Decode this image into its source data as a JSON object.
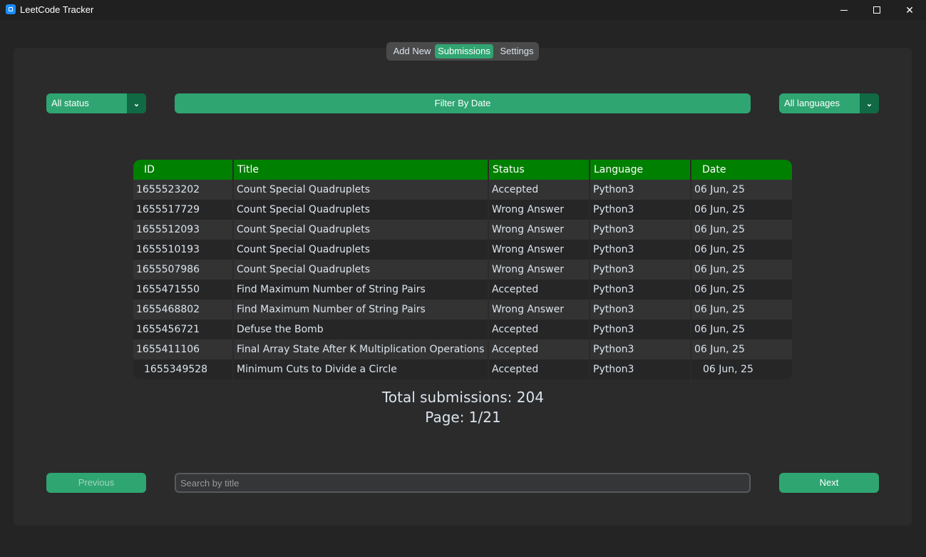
{
  "window": {
    "title": "LeetCode Tracker",
    "minimize": "",
    "maximize": "",
    "close": "✕"
  },
  "tabs": [
    {
      "label": "Add New",
      "selected": false
    },
    {
      "label": "Submissions",
      "selected": true
    },
    {
      "label": "Settings",
      "selected": false
    }
  ],
  "filters": {
    "status_selected": "All status",
    "date_button": "Filter By Date",
    "language_selected": "All languages"
  },
  "table": {
    "headers": [
      "ID",
      "Title",
      "Status",
      "Language",
      "Date"
    ],
    "rows": [
      {
        "id": "1655523202",
        "title": "Count Special Quadruplets",
        "status": "Accepted",
        "language": "Python3",
        "date": "06 Jun, 25"
      },
      {
        "id": "1655517729",
        "title": "Count Special Quadruplets",
        "status": "Wrong Answer",
        "language": "Python3",
        "date": "06 Jun, 25"
      },
      {
        "id": "1655512093",
        "title": "Count Special Quadruplets",
        "status": "Wrong Answer",
        "language": "Python3",
        "date": "06 Jun, 25"
      },
      {
        "id": "1655510193",
        "title": "Count Special Quadruplets",
        "status": "Wrong Answer",
        "language": "Python3",
        "date": "06 Jun, 25"
      },
      {
        "id": "1655507986",
        "title": "Count Special Quadruplets",
        "status": "Wrong Answer",
        "language": "Python3",
        "date": "06 Jun, 25"
      },
      {
        "id": "1655471550",
        "title": "Find Maximum Number of String Pairs",
        "status": "Accepted",
        "language": "Python3",
        "date": "06 Jun, 25"
      },
      {
        "id": "1655468802",
        "title": "Find Maximum Number of String Pairs",
        "status": "Wrong Answer",
        "language": "Python3",
        "date": "06 Jun, 25"
      },
      {
        "id": "1655456721",
        "title": "Defuse the Bomb",
        "status": "Accepted",
        "language": "Python3",
        "date": "06 Jun, 25"
      },
      {
        "id": "1655411106",
        "title": "Final Array State After K Multiplication Operations I",
        "status": "Accepted",
        "language": "Python3",
        "date": "06 Jun, 25"
      },
      {
        "id": "1655349528",
        "title": "Minimum Cuts to Divide a Circle",
        "status": "Accepted",
        "language": "Python3",
        "date": "06 Jun, 25"
      }
    ]
  },
  "summary": {
    "total": "Total submissions: 204",
    "page": "Page: 1/21"
  },
  "pagination": {
    "previous": "Previous",
    "next": "Next"
  },
  "search": {
    "placeholder": "Search by title",
    "value": ""
  },
  "colors": {
    "accent": "#2fa572",
    "accent_dark": "#106a43",
    "table_header": "#008000",
    "background": "#242424"
  }
}
